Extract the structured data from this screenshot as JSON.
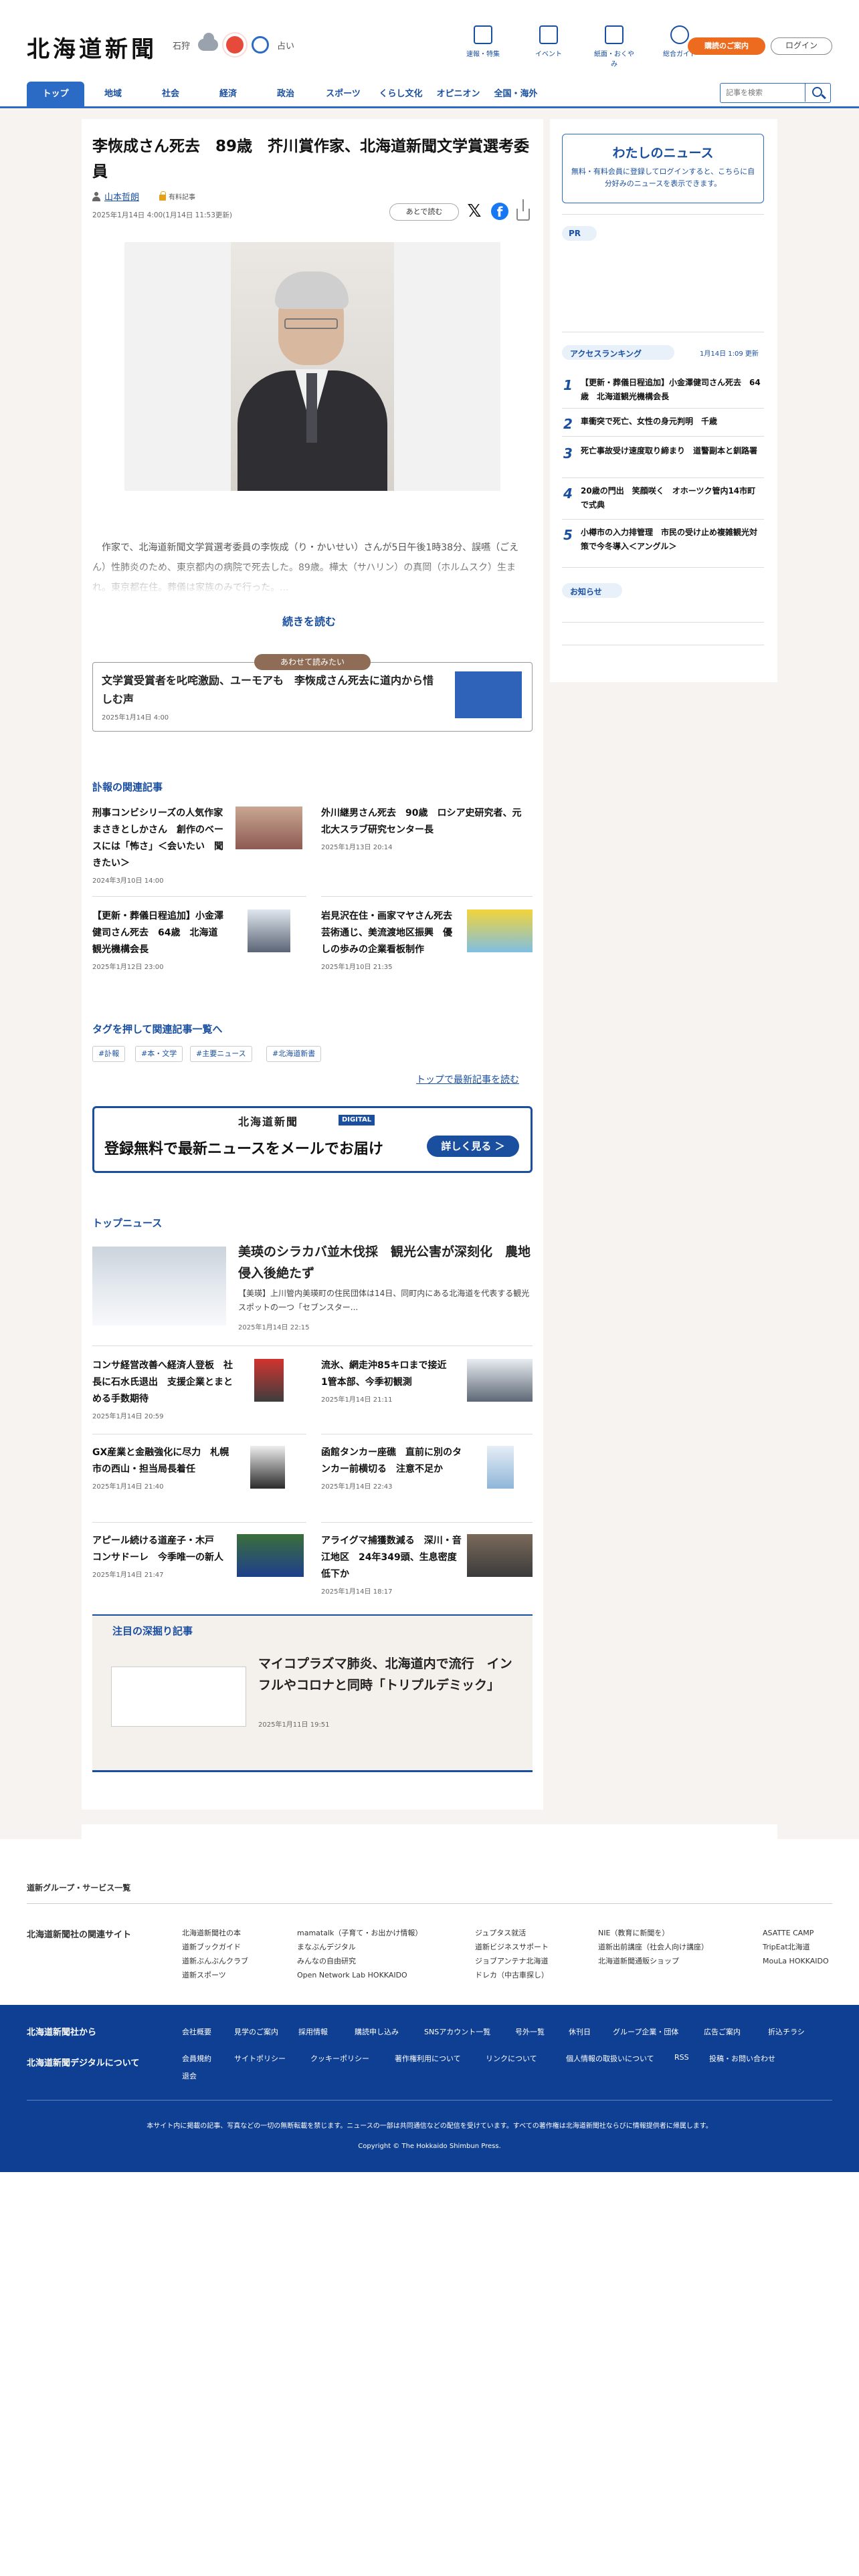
{
  "header": {
    "logo": "北海道新聞",
    "weather": {
      "location": "石狩",
      "fortune": "占い"
    },
    "links": [
      {
        "label": "速報・特集",
        "icon": "flag-icon"
      },
      {
        "label": "イベント",
        "icon": "calendar-icon"
      },
      {
        "label": "紙面・おくやみ",
        "icon": "newspaper-icon"
      },
      {
        "label": "総合ガイド",
        "icon": "help-icon"
      }
    ],
    "contract_label": "購読のご案内",
    "login_label": "ログイン"
  },
  "nav": {
    "items": [
      "トップ",
      "地域",
      "社会",
      "経済",
      "政治",
      "スポーツ",
      "くらし文化",
      "オピニオン",
      "全国・海外"
    ],
    "search_placeholder": "記事を検索"
  },
  "article": {
    "title": "李恢成さん死去　89歳　芥川賞作家、北海道新聞文学賞選考委員",
    "author": "山本哲朗",
    "member_label": "有料記事",
    "date": "2025年1月14日 4:00(1月14日 11:53更新)",
    "read_later": "あとで読む",
    "lead": "　作家で、北海道新聞文学賞選考委員の李恢成（り・かいせい）さんが5日午後1時38分、誤嚥（ごえん）性肺炎のため、東京都内の病院で死去した。89歳。樺太（サハリン）の真岡（ホルムスク）生まれ。東京都在住。葬儀は家族のみで行った。...",
    "more_label": "続きを読む"
  },
  "also_read": {
    "tag": "あわせて読みたい",
    "title": "文学賞受賞者を叱咤激励、ユーモアも　李恢成さん死去に道内から惜しむ声",
    "date": "2025年1月14日 4:00"
  },
  "related": {
    "heading": "訃報の関連記事",
    "items": [
      {
        "title": "刑事コンビシリーズの人気作家まさきとしかさん　創作のベースには「怖さ」＜会いたい　聞きたい＞",
        "date": "2024年3月10日 14:00"
      },
      {
        "title": "外川継男さん死去　90歳　ロシア史研究者、元北大スラブ研究センター長",
        "date": "2025年1月13日 20:14"
      },
      {
        "title": "【更新・葬儀日程追加】小金澤健司さん死去　64歳　北海道観光機構会長",
        "date": "2025年1月12日 23:00"
      },
      {
        "title": "岩見沢在住・画家マヤさん死去　芸術通じ、美流渡地区振興　優しの歩みの企業看板制作",
        "date": "2025年1月10日 21:35"
      }
    ]
  },
  "tags": {
    "heading": "タグを押して関連記事一覧へ",
    "items": [
      "#訃報",
      "#本・文学",
      "#主要ニュース",
      "#北海道新書"
    ]
  },
  "latest_link": "トップで最新記事を読む",
  "promo": {
    "logo": "北海道新聞",
    "digital": "DIGITAL",
    "text": "登録無料で最新ニュースをメールでお届け",
    "button": "詳しく見る ＞"
  },
  "top_news": {
    "heading": "トップニュース",
    "main": {
      "title": "美瑛のシラカバ並木伐採　観光公害が深刻化　農地侵入後絶たず",
      "lead": "【美瑛】上川管内美瑛町の住民団体は14日、同町内にある北海道を代表する観光スポットの一つ「セブンスター...",
      "date": "2025年1月14日 22:15"
    },
    "items": [
      {
        "title": "コンサ経営改善へ経済人登板　社長に石水氏退出　支援企業とまとめる手数期待",
        "date": "2025年1月14日 20:59"
      },
      {
        "title": "流氷、網走沖85キロまで接近　1管本部、今季初観測",
        "date": "2025年1月14日 21:11"
      },
      {
        "title": "GX産業と金融強化に尽力　札幌市の西山・担当局長着任",
        "date": "2025年1月14日 21:40"
      },
      {
        "title": "函館タンカー座礁　直前に別のタンカー前横切る　注意不足か",
        "date": "2025年1月14日 22:43"
      },
      {
        "title": "アピール続ける道産子・木戸　コンサドーレ　今季唯一の新人",
        "date": "2025年1月14日 21:47"
      },
      {
        "title": "アライグマ捕獲数減る　深川・音江地区　24年349頭、生息密度低下か",
        "date": "2025年1月14日 18:17"
      }
    ]
  },
  "deep_dive": {
    "heading": "注目の深掘り記事",
    "title": "マイコプラズマ肺炎、北海道内で流行　インフルやコロナと同時「トリプルデミック」",
    "date": "2025年1月11日 19:51"
  },
  "sidebar": {
    "mynews_title": "わたしのニュース",
    "mynews_text": "無料・有料会員に登録してログインすると、こちらに自分好みのニュースを表示できます。",
    "pr": "PR",
    "ranking_label": "アクセスランキング",
    "ranking_updated": "1月14日 1:09 更新",
    "ranking": [
      {
        "n": "1",
        "title": "【更新・葬儀日程追加】小金澤健司さん死去　64歳　北海道観光機構会長"
      },
      {
        "n": "2",
        "title": "車衝突で死亡、女性の身元判明　千歳"
      },
      {
        "n": "3",
        "title": "死亡事故受け速度取り締まり　道警副本と釧路署"
      },
      {
        "n": "4",
        "title": "20歳の門出　笑顔咲く　オホーツク管内14市町で式典"
      },
      {
        "n": "5",
        "title": "小樽市の入力排管理　市民の受け止め複雑観光対策で今冬導入＜アングル＞"
      }
    ],
    "notice": "お知らせ"
  },
  "footer": {
    "group_link": "道新グループ・サービス一覧",
    "sites_heading": "北海道新聞社の関連サイト",
    "sites": [
      [
        "北海道新聞社の本",
        "道新ブックガイド",
        "道新ぶんぶんクラブ",
        "道新スポーツ"
      ],
      [
        "mamatalk（子育て・お出かけ情報）",
        "まなぶんデジタル",
        "みんなの自由研究",
        "Open Network Lab HOKKAIDO"
      ],
      [
        "ジュプタス就活",
        "道新ビジネスサポート",
        "ジョブアンテナ北海道",
        "ドレカ（中古車探し）"
      ],
      [
        "NIE（教育に新聞を）",
        "道新出前講座（社会人向け講座）",
        "北海道新聞通販ショップ"
      ],
      [
        "ASATTE CAMP",
        "TripEat北海道",
        "MouLa HOKKAIDO"
      ]
    ],
    "blue": {
      "heading1": "北海道新聞社から",
      "heading2": "北海道新聞デジタルについて",
      "row1": [
        "会社概要",
        "見学のご案内",
        "採用情報",
        "購読申し込み",
        "SNSアカウント一覧",
        "号外一覧",
        "休刊日",
        "グループ企業・団体",
        "広告ご案内",
        "折込チラシ"
      ],
      "row2": [
        "会員規約",
        "サイトポリシー",
        "クッキーポリシー",
        "著作権利用について",
        "リンクについて",
        "個人情報の取扱いについて",
        "RSS",
        "投稿・お問い合わせ",
        "退会"
      ],
      "note": "本サイト内に掲載の記事、写真などの一切の無断転載を禁じます。ニュースの一部は共同通信などの配信を受けています。すべての著作権は北海道新聞社ならびに情報提供者に帰属します。",
      "copyright": "Copyright © The Hokkaido Shimbun Press."
    }
  },
  "colors": {
    "brand_blue": "#1a4fa0",
    "accent_orange": "#ec6b1e",
    "footer_blue": "#0f3f92"
  }
}
